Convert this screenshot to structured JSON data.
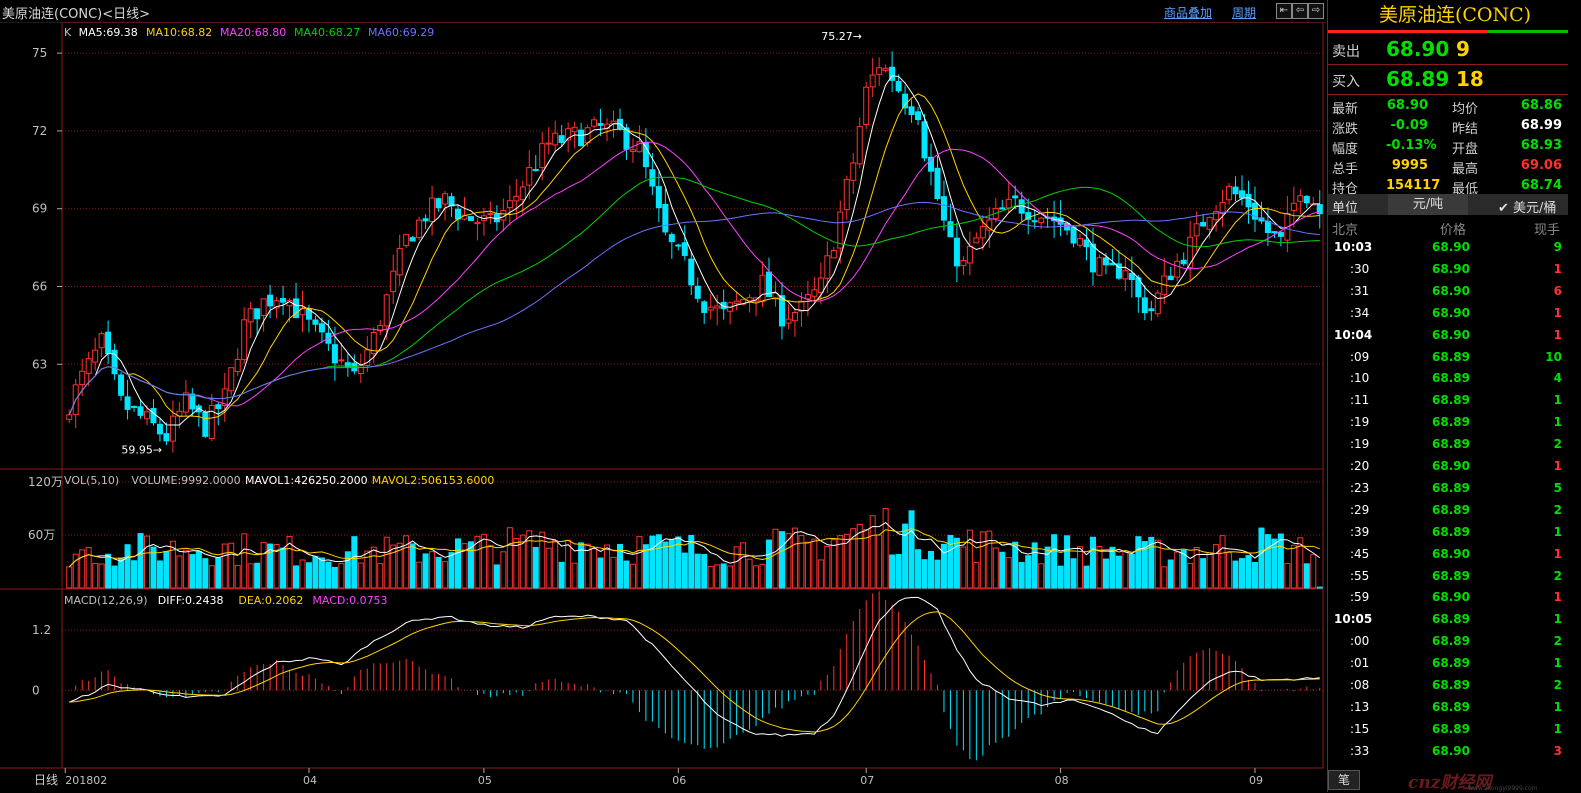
{
  "window": {
    "title": "美原油连(CONC)<日线>",
    "links": [
      "商品叠加",
      "周期"
    ],
    "buttons": [
      "⇤",
      "⇦",
      "⇨",
      "⇥"
    ]
  },
  "chart_data": [
    {
      "type": "candlestick",
      "panel": "price",
      "legend": [
        {
          "label": "K",
          "color": "#c0c0c0"
        },
        {
          "label": "MA5:69.38",
          "color": "#ffffff"
        },
        {
          "label": "MA10:68.82",
          "color": "#ffd200"
        },
        {
          "label": "MA20:68.80",
          "color": "#ff40ff"
        },
        {
          "label": "MA40:68.27",
          "color": "#00d000"
        },
        {
          "label": "MA60:69.29",
          "color": "#7070ff"
        }
      ],
      "yticks": [
        75,
        72,
        69,
        66,
        63
      ],
      "ylim": [
        59,
        76.2
      ],
      "annotations": [
        {
          "text": "75.27",
          "x": 123,
          "y": 75.27
        },
        {
          "text": "59.95",
          "x": 15,
          "y": 59.95
        }
      ],
      "x_labels": [
        {
          "label": "201802",
          "x": 0
        },
        {
          "label": "04",
          "x": 37
        },
        {
          "label": "05",
          "x": 64
        },
        {
          "label": "06",
          "x": 94
        },
        {
          "label": "07",
          "x": 123
        },
        {
          "label": "08",
          "x": 153
        },
        {
          "label": "09",
          "x": 183
        }
      ],
      "anchors": [
        [
          0,
          61.5
        ],
        [
          2,
          62.5
        ],
        [
          5,
          63.8
        ],
        [
          8,
          61.5
        ],
        [
          12,
          60.8
        ],
        [
          15,
          60.2
        ],
        [
          18,
          61.5
        ],
        [
          21,
          60.6
        ],
        [
          24,
          61.7
        ],
        [
          27,
          64.5
        ],
        [
          30,
          65.4
        ],
        [
          33,
          65.8
        ],
        [
          36,
          64.8
        ],
        [
          40,
          63.6
        ],
        [
          44,
          62.5
        ],
        [
          47,
          64.0
        ],
        [
          50,
          66.3
        ],
        [
          52,
          67.8
        ],
        [
          55,
          68.8
        ],
        [
          58,
          69.3
        ],
        [
          61,
          68.7
        ],
        [
          65,
          68.4
        ],
        [
          68,
          69.1
        ],
        [
          71,
          70.4
        ],
        [
          74,
          71.5
        ],
        [
          78,
          71.8
        ],
        [
          82,
          72.1
        ],
        [
          85,
          71.9
        ],
        [
          88,
          71.3
        ],
        [
          90,
          69.6
        ],
        [
          92,
          67.9
        ],
        [
          95,
          66.8
        ],
        [
          98,
          65.4
        ],
        [
          101,
          64.9
        ],
        [
          104,
          65.5
        ],
        [
          107,
          66.1
        ],
        [
          110,
          64.9
        ],
        [
          113,
          65.1
        ],
        [
          116,
          66.0
        ],
        [
          118,
          67.8
        ],
        [
          121,
          70.8
        ],
        [
          123,
          73.5
        ],
        [
          125,
          74.6
        ],
        [
          127,
          74.1
        ],
        [
          129,
          73.2
        ],
        [
          131,
          72.8
        ],
        [
          132,
          71.3
        ],
        [
          134,
          69.4
        ],
        [
          136,
          67.5
        ],
        [
          138,
          66.8
        ],
        [
          140,
          67.8
        ],
        [
          143,
          68.7
        ],
        [
          146,
          69.2
        ],
        [
          149,
          68.9
        ],
        [
          152,
          68.6
        ],
        [
          155,
          68.1
        ],
        [
          157,
          67.3
        ],
        [
          160,
          66.4
        ],
        [
          163,
          66.8
        ],
        [
          165,
          65.5
        ],
        [
          167,
          65.1
        ],
        [
          170,
          66.6
        ],
        [
          173,
          67.6
        ],
        [
          176,
          69.0
        ],
        [
          179,
          69.7
        ],
        [
          182,
          69.2
        ],
        [
          185,
          68.1
        ],
        [
          187,
          67.7
        ],
        [
          190,
          69.9
        ],
        [
          192,
          69.3
        ],
        [
          193,
          68.9
        ]
      ]
    },
    {
      "type": "bar",
      "panel": "volume",
      "legend": [
        {
          "label": "VOL(5,10)",
          "color": "#c0c0c0"
        },
        {
          "label": "VOLUME:9992.0000",
          "color": "#c0c0c0"
        },
        {
          "label": "MAVOL1:426250.2000",
          "color": "#ffffff"
        },
        {
          "label": "MAVOL2:506153.6000",
          "color": "#ffd200"
        }
      ],
      "yticks": [
        "120万",
        "60万"
      ],
      "ylim": [
        0,
        1200000
      ],
      "anchors": [
        [
          0,
          400000
        ],
        [
          20,
          460000
        ],
        [
          40,
          400000
        ],
        [
          60,
          440000
        ],
        [
          75,
          520000
        ],
        [
          85,
          480000
        ],
        [
          100,
          420000
        ],
        [
          115,
          500000
        ],
        [
          125,
          700000
        ],
        [
          135,
          520000
        ],
        [
          150,
          440000
        ],
        [
          170,
          400000
        ],
        [
          185,
          500000
        ],
        [
          193,
          380000
        ]
      ]
    },
    {
      "type": "macd",
      "panel": "macd",
      "legend": [
        {
          "label": "MACD(12,26,9)",
          "color": "#c0c0c0"
        },
        {
          "label": "DIFF:0.2438",
          "color": "#ffffff"
        },
        {
          "label": "DEA:0.2062",
          "color": "#ffd200"
        },
        {
          "label": "MACD:0.0753",
          "color": "#ff40ff"
        }
      ],
      "yticks": [
        1.2,
        0
      ],
      "ylim": [
        -1.55,
        2.0
      ],
      "anchors": [
        [
          0,
          -0.25
        ],
        [
          6,
          0.1
        ],
        [
          12,
          0.0
        ],
        [
          18,
          -0.15
        ],
        [
          24,
          -0.1
        ],
        [
          28,
          0.25
        ],
        [
          32,
          0.55
        ],
        [
          38,
          0.65
        ],
        [
          42,
          0.5
        ],
        [
          46,
          0.9
        ],
        [
          52,
          1.35
        ],
        [
          58,
          1.48
        ],
        [
          64,
          1.3
        ],
        [
          70,
          1.25
        ],
        [
          74,
          1.45
        ],
        [
          80,
          1.48
        ],
        [
          86,
          1.4
        ],
        [
          90,
          0.9
        ],
        [
          95,
          0.2
        ],
        [
          100,
          -0.5
        ],
        [
          105,
          -0.85
        ],
        [
          110,
          -0.9
        ],
        [
          115,
          -0.85
        ],
        [
          118,
          -0.5
        ],
        [
          121,
          0.3
        ],
        [
          125,
          1.4
        ],
        [
          128,
          1.8
        ],
        [
          131,
          1.85
        ],
        [
          134,
          1.6
        ],
        [
          137,
          0.8
        ],
        [
          140,
          0.2
        ],
        [
          145,
          -0.15
        ],
        [
          150,
          -0.3
        ],
        [
          155,
          -0.2
        ],
        [
          160,
          -0.4
        ],
        [
          165,
          -0.75
        ],
        [
          168,
          -0.85
        ],
        [
          172,
          -0.3
        ],
        [
          176,
          0.2
        ],
        [
          180,
          0.4
        ],
        [
          184,
          0.2
        ],
        [
          188,
          0.22
        ],
        [
          193,
          0.24
        ]
      ]
    }
  ],
  "quote": {
    "name": "美原油连(CONC)",
    "sell_label": "卖出",
    "sell_price": "68.90",
    "sell_vol": "9",
    "buy_label": "买入",
    "buy_price": "68.89",
    "buy_vol": "18",
    "fields": [
      {
        "l": "最新",
        "v": "68.90",
        "vc": "gr",
        "l2": "均价",
        "v2": "68.86",
        "v2c": "gr"
      },
      {
        "l": "涨跌",
        "v": "-0.09",
        "vc": "gr",
        "l2": "昨结",
        "v2": "68.99",
        "v2c": "wh"
      },
      {
        "l": "幅度",
        "v": "-0.13%",
        "vc": "gr",
        "l2": "开盘",
        "v2": "68.93",
        "v2c": "gr"
      },
      {
        "l": "总手",
        "v": "9995",
        "vc": "yl",
        "l2": "最高",
        "v2": "69.06",
        "v2c": "rd"
      },
      {
        "l": "持仓",
        "v": "154117",
        "vc": "yl",
        "l2": "最低",
        "v2": "68.74",
        "v2c": "gr"
      }
    ],
    "unit_label": "单位",
    "unit_value": "元/吨",
    "unit_check": "✔ 美元/桶",
    "ticks_header": [
      "北京",
      "价格",
      "现手"
    ],
    "ticks": [
      {
        "t": "10:03",
        "bold": true,
        "p": "68.90",
        "v": "9",
        "vc": "gr"
      },
      {
        "t": ":30",
        "p": "68.90",
        "v": "1",
        "vc": "rd"
      },
      {
        "t": ":31",
        "p": "68.90",
        "v": "6",
        "vc": "rd"
      },
      {
        "t": ":34",
        "p": "68.90",
        "v": "1",
        "vc": "rd"
      },
      {
        "t": "10:04",
        "bold": true,
        "p": "68.90",
        "v": "1",
        "vc": "rd"
      },
      {
        "t": ":09",
        "p": "68.89",
        "v": "10",
        "vc": "gr"
      },
      {
        "t": ":10",
        "p": "68.89",
        "v": "4",
        "vc": "gr"
      },
      {
        "t": ":11",
        "p": "68.89",
        "v": "1",
        "vc": "gr"
      },
      {
        "t": ":19",
        "p": "68.89",
        "v": "1",
        "vc": "gr"
      },
      {
        "t": ":19",
        "p": "68.89",
        "v": "2",
        "vc": "gr"
      },
      {
        "t": ":20",
        "p": "68.90",
        "v": "1",
        "vc": "rd"
      },
      {
        "t": ":23",
        "p": "68.89",
        "v": "5",
        "vc": "gr"
      },
      {
        "t": ":29",
        "p": "68.89",
        "v": "2",
        "vc": "gr"
      },
      {
        "t": ":39",
        "p": "68.89",
        "v": "1",
        "vc": "gr"
      },
      {
        "t": ":45",
        "p": "68.90",
        "v": "1",
        "vc": "rd"
      },
      {
        "t": ":55",
        "p": "68.89",
        "v": "2",
        "vc": "gr"
      },
      {
        "t": ":59",
        "p": "68.90",
        "v": "1",
        "vc": "rd"
      },
      {
        "t": "10:05",
        "bold": true,
        "p": "68.89",
        "v": "1",
        "vc": "gr"
      },
      {
        "t": ":00",
        "p": "68.89",
        "v": "2",
        "vc": "gr"
      },
      {
        "t": ":01",
        "p": "68.89",
        "v": "1",
        "vc": "gr"
      },
      {
        "t": ":08",
        "p": "68.89",
        "v": "2",
        "vc": "gr"
      },
      {
        "t": ":13",
        "p": "68.89",
        "v": "1",
        "vc": "gr"
      },
      {
        "t": ":15",
        "p": "68.89",
        "v": "1",
        "vc": "gr"
      },
      {
        "t": ":33",
        "p": "68.90",
        "v": "3",
        "vc": "rd"
      }
    ],
    "tab_label": "笔",
    "watermark": "cnz财经网",
    "watermark_url": "www.zhongyi9999.com"
  },
  "axis_bottom_label": "日线",
  "colors": {
    "up": "#ff3030",
    "down": "#00e5ff",
    "grid": "#8b1a1a"
  }
}
